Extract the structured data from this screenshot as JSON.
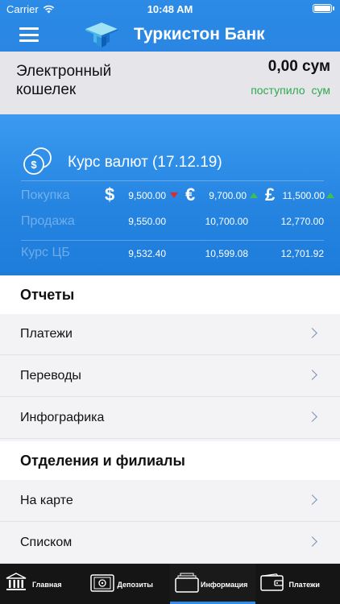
{
  "status_bar": {
    "carrier": "Carrier",
    "time": "10:48 AM"
  },
  "header": {
    "title": "Туркистон Банк"
  },
  "wallet": {
    "label": "Электронный кошелек",
    "amount": "0,00 сум",
    "income": "поступило сум"
  },
  "rates": {
    "title": "Курс валют (17.12.19)",
    "rows": [
      {
        "label": "Покупка",
        "usd": "9,500.00",
        "eur": "9,700.00",
        "gbp": "11,500.00"
      },
      {
        "label": "Продажа",
        "usd": "9,550.00",
        "eur": "10,700.00",
        "gbp": "12,770.00"
      },
      {
        "label": "Курс ЦБ",
        "usd": "9,532.40",
        "eur": "10,599.08",
        "gbp": "12,701.92"
      }
    ],
    "symbols": {
      "usd": "$",
      "eur": "€",
      "gbp": "£"
    },
    "colors": {
      "down": "#e02b2b",
      "up": "#3dbf55"
    }
  },
  "sections": {
    "reports": {
      "title": "Отчеты",
      "items": [
        {
          "label": "Платежи"
        },
        {
          "label": "Переводы"
        },
        {
          "label": "Инфографика"
        }
      ]
    },
    "branches": {
      "title": "Отделения и филиалы",
      "items": [
        {
          "label": "На карте"
        },
        {
          "label": "Списком"
        }
      ]
    }
  },
  "tabbar": {
    "active": "Информация",
    "tabs": [
      {
        "label": "Главная",
        "icon": "bank-icon"
      },
      {
        "label": "Депозиты",
        "icon": "safe-icon"
      },
      {
        "label": "Информация",
        "icon": "folder-icon"
      },
      {
        "label": "Платежи",
        "icon": "wallet-icon"
      }
    ]
  },
  "colors": {
    "accent": "#2a86e2",
    "income": "#2fa84f"
  }
}
